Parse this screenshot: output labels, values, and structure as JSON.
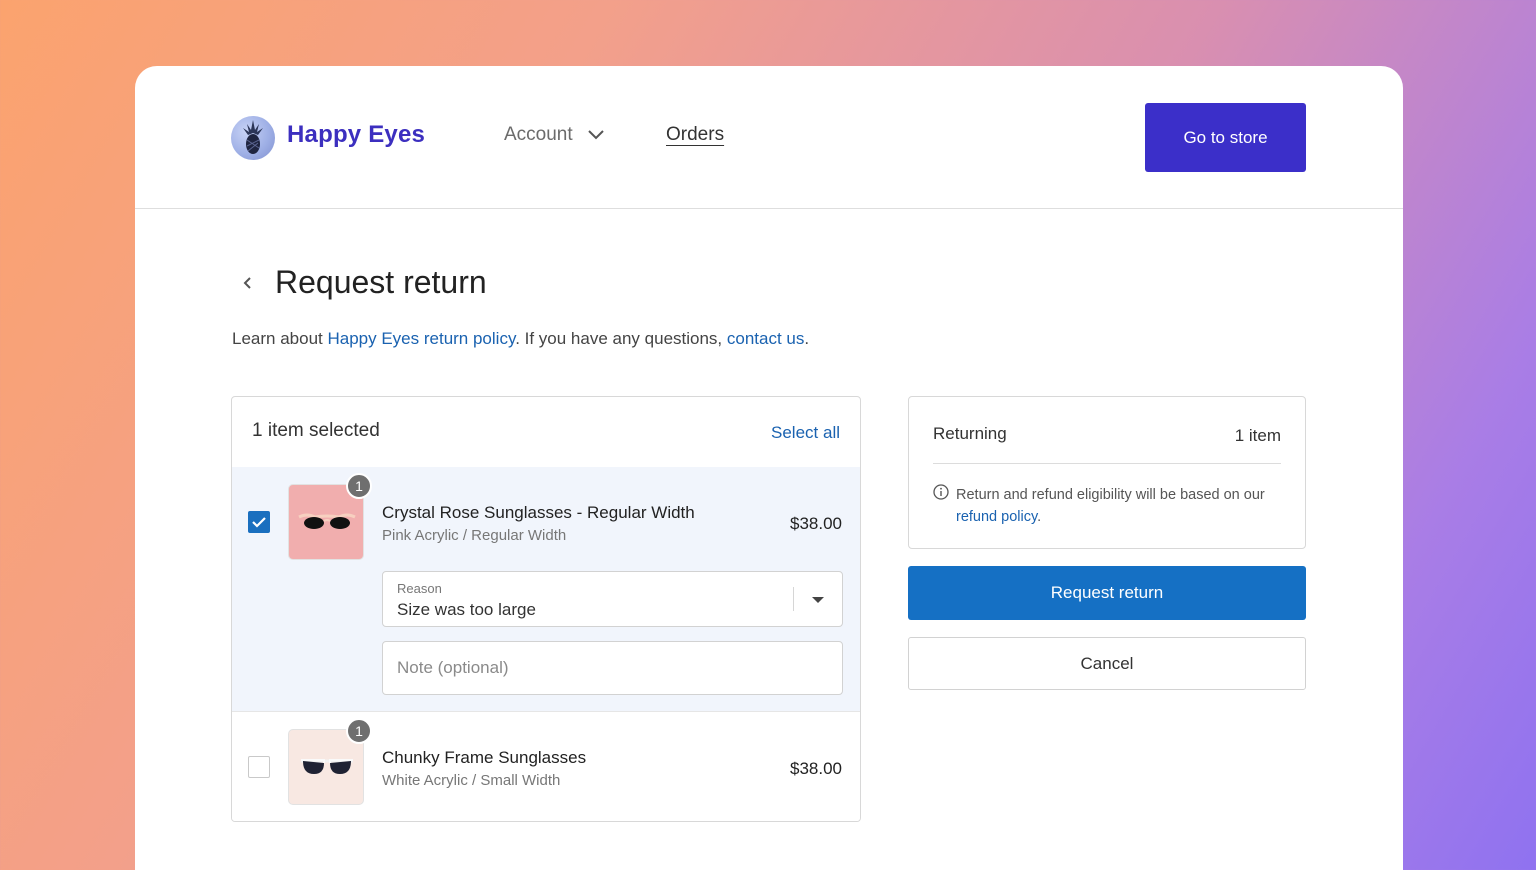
{
  "header": {
    "brand": "Happy Eyes",
    "nav": {
      "account": "Account",
      "orders": "Orders"
    },
    "store_button": "Go to store"
  },
  "page": {
    "title": "Request return",
    "intro": {
      "prefix": "Learn about ",
      "policy_link": "Happy Eyes return policy",
      "middle": ". If you have any questions, ",
      "contact_link": "contact us",
      "suffix": "."
    }
  },
  "items_panel": {
    "selected_count": "1 item selected",
    "select_all": "Select all",
    "items": [
      {
        "name": "Crystal Rose Sunglasses - Regular Width",
        "variant": "Pink Acrylic / Regular Width",
        "price": "$38.00",
        "quantity": "1",
        "checked": true,
        "reason_label": "Reason",
        "reason_value": "Size was too large",
        "note_placeholder": "Note (optional)"
      },
      {
        "name": "Chunky Frame Sunglasses",
        "variant": "White Acrylic / Small Width",
        "price": "$38.00",
        "quantity": "1",
        "checked": false
      }
    ]
  },
  "summary": {
    "label": "Returning",
    "count": "1 item",
    "note": "Return and refund eligibility will be based on our",
    "note_link": "refund policy",
    "note_end": "."
  },
  "actions": {
    "request_return": "Request return",
    "cancel": "Cancel"
  },
  "colors": {
    "brand": "#3c2fbf",
    "store_button": "#3b2fc9",
    "primary_action": "#1570c4",
    "link": "#1a62b0",
    "thumb_pink": "#f1aeae",
    "thumb_white": "#f8e8e2"
  },
  "icons": {
    "logo": "pineapple-logo-icon",
    "account_caret": "chevron-down-icon",
    "back": "chevron-left-icon",
    "check": "checkmark-icon",
    "info": "info-icon",
    "dropdown": "caret-down-icon"
  }
}
